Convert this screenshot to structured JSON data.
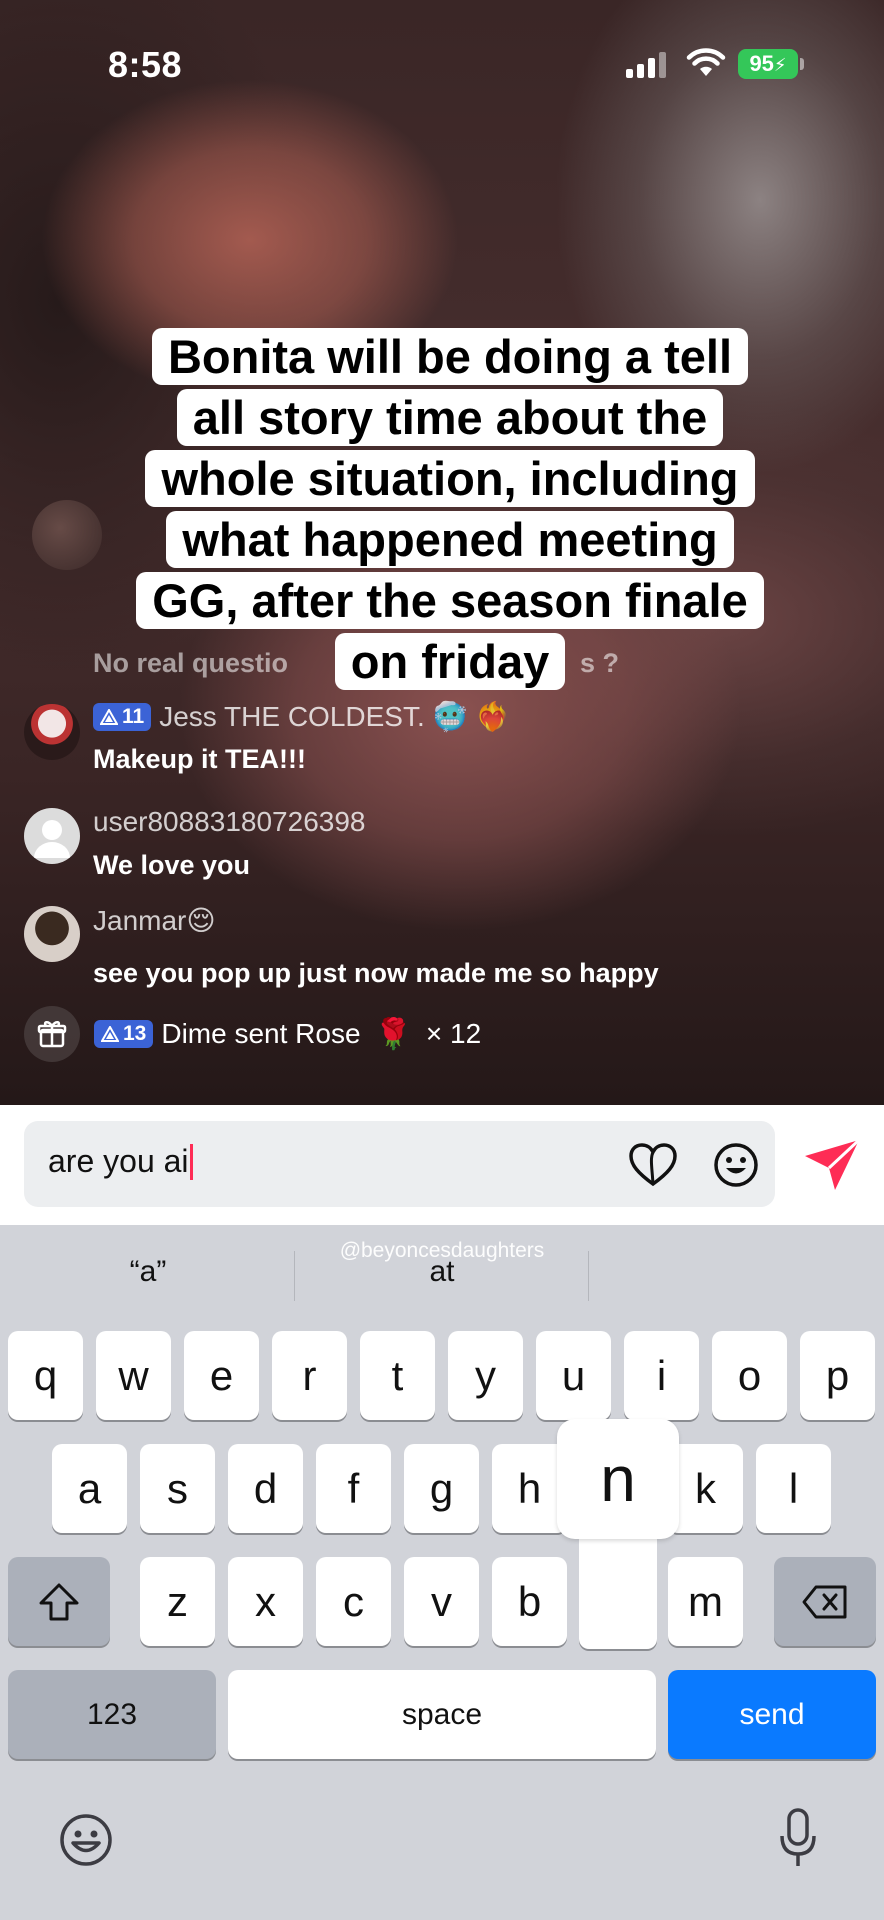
{
  "status_bar": {
    "time": "8:58",
    "battery": "95"
  },
  "caption": {
    "lines": [
      "Bonita will be doing a tell",
      "all story time about the",
      "whole situation, including",
      "what happened meeting",
      "GG, after the season finale",
      "on friday"
    ]
  },
  "partial_comment": {
    "start": "No real questio",
    "end": "s ?"
  },
  "comments": [
    {
      "level": "11",
      "name": "Jess THE COLDEST.",
      "name_emoji": "🥶 ❤️‍🔥",
      "text": "Makeup it TEA!!!"
    },
    {
      "name": "user80883180726398",
      "text": "We love you"
    },
    {
      "name": "Janmar",
      "name_emoji": "😌",
      "text": "see you pop up just now made me so happy"
    }
  ],
  "gift": {
    "level": "13",
    "text": "Dime sent Rose",
    "emoji": "🌹",
    "count": "× 12"
  },
  "input": {
    "value": "are you ai"
  },
  "keyboard": {
    "mention_hint": "@beyoncesdaughters",
    "suggestions": [
      "“a”",
      "at",
      ""
    ],
    "row1": [
      "q",
      "w",
      "e",
      "r",
      "t",
      "y",
      "u",
      "i",
      "o",
      "p"
    ],
    "row2": [
      "a",
      "s",
      "d",
      "f",
      "g",
      "h",
      "j",
      "k",
      "l"
    ],
    "row3": [
      "z",
      "x",
      "c",
      "v",
      "b",
      "n",
      "m"
    ],
    "popup_key": "n",
    "numbers_label": "123",
    "space_label": "space",
    "send_label": "send"
  },
  "colors": {
    "accent": "#fe2c55",
    "keyboard_send": "#0a7aff",
    "battery": "#34c759",
    "level_badge": "#3b63d6"
  }
}
